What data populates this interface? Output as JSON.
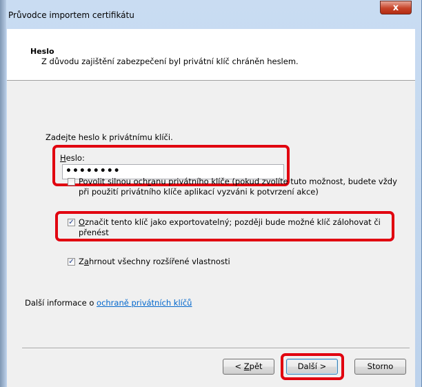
{
  "window": {
    "title": "Průvodce importem certifikátu",
    "close_glyph": "x"
  },
  "header": {
    "title": "Heslo",
    "description": "Z důvodu zajištění zabezpečení byl privátní klíč chráněn heslem."
  },
  "instruction": "Zadejte heslo k privátnímu klíči.",
  "password": {
    "label_accel": "H",
    "label_rest": "eslo:",
    "value": "••••••••"
  },
  "options": {
    "strong_protection": {
      "checked": false,
      "line1_a": "Povolit silnou och",
      "line1_accel": "r",
      "line1_b": "anu privátního klíče (pokud zvolíte tuto možnost, budete vždy",
      "line2": "při použití privátního klíče aplikací vyzváni k potvrzení akce)"
    },
    "exportable": {
      "checked": true,
      "line1_accel": "O",
      "line1_rest": "značit tento klíč jako exportovatelný; později bude možné klíč zálohovat či",
      "line2": "přenést"
    },
    "include_properties": {
      "checked": true,
      "text_a": "Z",
      "text_accel": "a",
      "text_b": "hrnout všechny rozšířené vlastnosti"
    }
  },
  "more_info": {
    "prefix": "Další informace o ",
    "link": "ochraně privátních klíčů"
  },
  "buttons": {
    "back_prefix": "< ",
    "back_accel": "Z",
    "back_rest": "pět",
    "next": "Další >",
    "cancel": "Storno"
  },
  "colors": {
    "highlight": "#e1000f",
    "link": "#0066cc"
  }
}
